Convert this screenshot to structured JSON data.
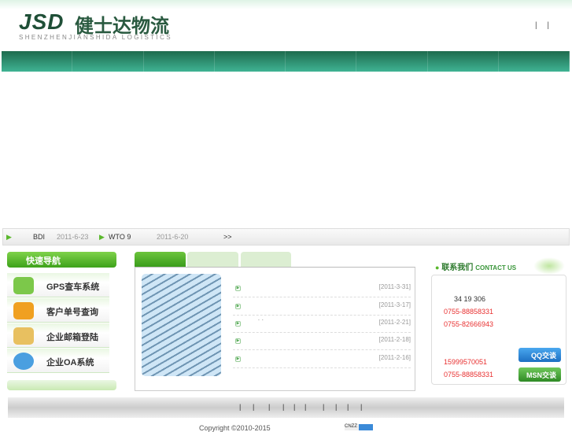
{
  "header": {
    "logo_mark": "JSD",
    "logo_cn": "健士达物流",
    "logo_en": "SHENZHENJIANSHIDA LOGISTICS",
    "top_links": "| |"
  },
  "nav": {
    "items": [
      "",
      "",
      "",
      "",
      "",
      "",
      "",
      ""
    ]
  },
  "news_ticker": {
    "items": [
      {
        "title": "BDI",
        "date": "2011-6-23"
      },
      {
        "title": "WTO  9",
        "date": "2011-6-20"
      }
    ],
    "more": ">>"
  },
  "quick_nav": {
    "title": "快速导航",
    "items": [
      {
        "label": "GPS查车系统",
        "icon": "gps-map-icon",
        "color": "#7cc84a"
      },
      {
        "label": "客户单号查询",
        "icon": "cubes-icon",
        "color": "#f0a020"
      },
      {
        "label": "企业邮箱登陆",
        "icon": "envelope-icon",
        "color": "#e8c060"
      },
      {
        "label": "企业OA系统",
        "icon": "oa-person-icon",
        "color": "#4a9fe0"
      }
    ]
  },
  "news_list": {
    "items": [
      {
        "title": "",
        "date": "[2011-3-31]"
      },
      {
        "title": "",
        "date": "[2011-3-17]"
      },
      {
        "title": "˙ ˙",
        "date": "[2011-2-21]"
      },
      {
        "title": "",
        "date": "[2011-2-18]"
      },
      {
        "title": "",
        "date": "[2011-2-16]"
      }
    ]
  },
  "contact": {
    "title": "联系我们",
    "title_en": "CONTACT US",
    "address": "34   19     306",
    "phone1": "0755-88858331",
    "phone2": "0755-82666943",
    "mobile": "15999570051",
    "phone3": "0755-88858331",
    "qq_label": "QQ交谈",
    "msn_label": "MSN交谈",
    "accent": "#e83030"
  },
  "footer": {
    "separators": [
      "|",
      "|",
      "|",
      "|",
      "|",
      "|",
      "|",
      "|",
      "|",
      "|"
    ],
    "copyright": "Copyright ©2010-2015",
    "badge": "CNZZ"
  }
}
